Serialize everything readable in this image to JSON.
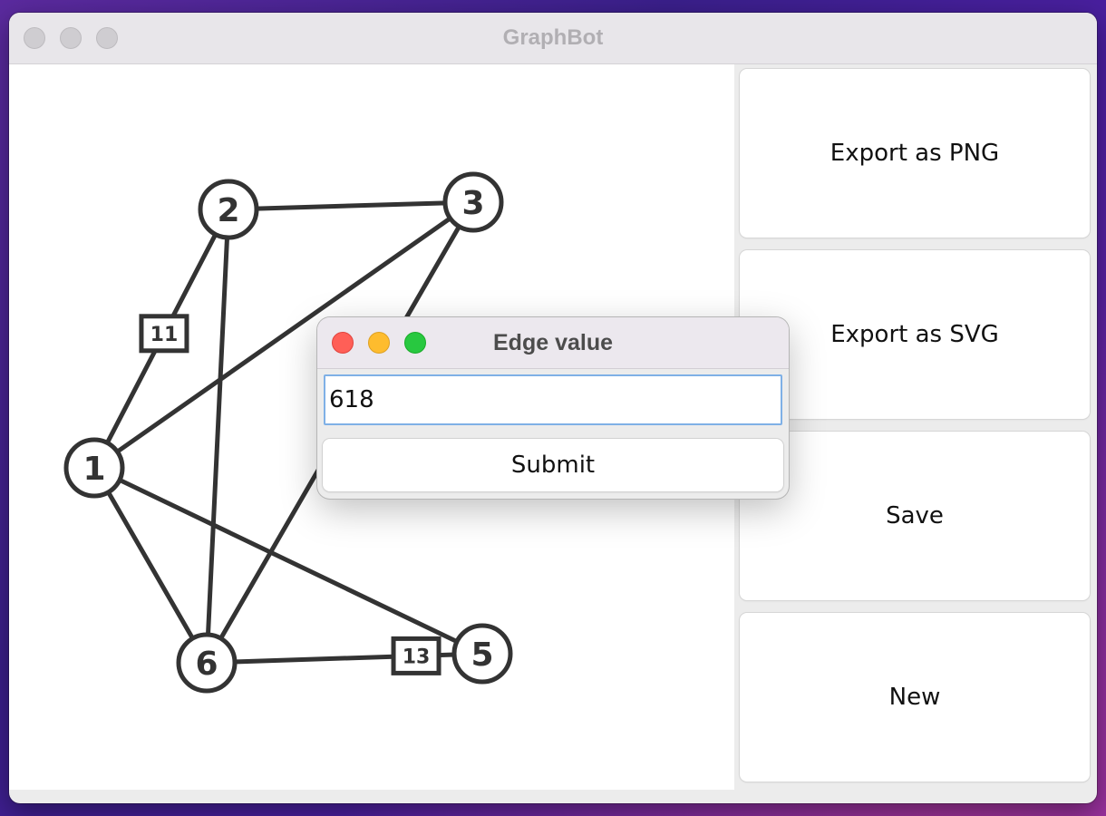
{
  "window": {
    "title": "GraphBot"
  },
  "graph": {
    "nodes": [
      {
        "id": "1",
        "label": "1"
      },
      {
        "id": "2",
        "label": "2"
      },
      {
        "id": "3",
        "label": "3"
      },
      {
        "id": "5",
        "label": "5"
      },
      {
        "id": "6",
        "label": "6"
      }
    ],
    "edges": [
      {
        "from": "1",
        "to": "2",
        "label": "11"
      },
      {
        "from": "1",
        "to": "3"
      },
      {
        "from": "1",
        "to": "5"
      },
      {
        "from": "1",
        "to": "6"
      },
      {
        "from": "2",
        "to": "6"
      },
      {
        "from": "2",
        "to": "3"
      },
      {
        "from": "3",
        "to": "6"
      },
      {
        "from": "6",
        "to": "5",
        "label": "13"
      }
    ]
  },
  "sidebar": {
    "buttons": [
      {
        "label": "Export as PNG"
      },
      {
        "label": "Export as SVG"
      },
      {
        "label": "Save"
      },
      {
        "label": "New"
      }
    ]
  },
  "dialog": {
    "title": "Edge value",
    "input_value": "618",
    "submit_label": "Submit"
  },
  "colors": {
    "stroke": "#333333",
    "close": "#ff5f57",
    "minimize": "#febc2e",
    "zoom": "#28c840"
  }
}
